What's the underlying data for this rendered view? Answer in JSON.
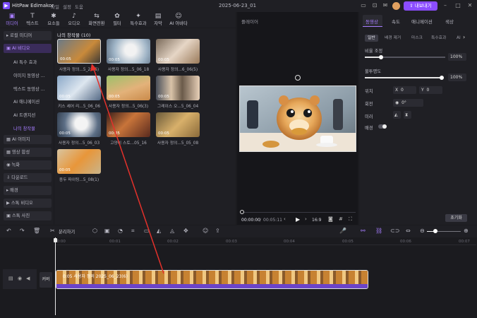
{
  "app": {
    "title": "HitPaw Edimakor",
    "project_title": "2025-06-23_01",
    "export_label": "내보내기"
  },
  "menu": [
    "파일",
    "설정",
    "도움"
  ],
  "toolbar": [
    {
      "label": "미디어",
      "icon": "folder-icon",
      "active": true
    },
    {
      "label": "텍스트",
      "icon": "text-icon"
    },
    {
      "label": "요소들",
      "icon": "elements-icon"
    },
    {
      "label": "오디오",
      "icon": "audio-icon"
    },
    {
      "label": "화면전환",
      "icon": "transition-icon"
    },
    {
      "label": "필터",
      "icon": "filter-icon"
    },
    {
      "label": "특수효과",
      "icon": "effects-icon"
    },
    {
      "label": "자막",
      "icon": "subtitle-icon"
    },
    {
      "label": "AI 아바타",
      "icon": "avatar-icon"
    }
  ],
  "sidebar": {
    "local_media": "로컬 미디어",
    "ai_video": "AI 비디오",
    "ai_sub": [
      "AI 특수 효과",
      "이미지 동영상 ...",
      "텍스트 동영상 ...",
      "AI 애니메이션",
      "AI 트랜지션",
      "나의 창작물"
    ],
    "ai_image": "AI 이미지",
    "video_merge": "영상 합성",
    "record": "녹화",
    "download": "다운로드",
    "background": "배경",
    "stock_video": "스톡 비디오",
    "stock_photo": "스톡 사진"
  },
  "media": {
    "header": "나의 창작물 (10)",
    "items": [
      {
        "label": "사용자 정의...5_23(6)",
        "duration": "00:05"
      },
      {
        "label": "사용자 정의...5_06_18",
        "duration": "00:05"
      },
      {
        "label": "사용자 정의...6_06(5)",
        "duration": "00:05"
      },
      {
        "label": "키스 셰어 리...5_06_06",
        "duration": "00:05"
      },
      {
        "label": "사용자 정의...5_06(3)",
        "duration": "00:05"
      },
      {
        "label": "그레이스 오...5_06_04",
        "duration": "00:05"
      },
      {
        "label": "사용자 정의...5_06_03",
        "duration": "00:05"
      },
      {
        "label": "고양이 스토...05_16",
        "duration": "00:05"
      },
      {
        "label": "사용자 정의...5_05_08",
        "duration": "00:05"
      },
      {
        "label": "종두 파이팅...5_08(1)",
        "duration": "00:05"
      }
    ]
  },
  "preview": {
    "title": "플레이어",
    "current_time": "00:00:00",
    "total_time": "00:05:11",
    "aspect": "16:9"
  },
  "right_panel": {
    "tabs": [
      "동영상",
      "속도",
      "애니메이션",
      "색상"
    ],
    "subtabs": [
      "일반",
      "배경 제거",
      "마스크",
      "특수효과",
      "AI"
    ],
    "scale_label": "비율 조정",
    "scale_value": "100%",
    "scale_fraction": 0.2,
    "opacity_label": "불투명도",
    "opacity_value": "100%",
    "opacity_fraction": 1.0,
    "position_label": "위치",
    "pos_x_label": "X",
    "pos_x": "0",
    "pos_y_label": "Y",
    "pos_y": "0",
    "rotate_label": "회전",
    "rotate_value": "0°",
    "mirror_label": "미러",
    "background_label": "배경",
    "reset_label": "초기화"
  },
  "timeline": {
    "split_label": "분리하기",
    "ticks": [
      "00:00",
      "00:01",
      "00:02",
      "00:03",
      "00:04",
      "00:05",
      "00:06",
      "00:07"
    ],
    "track_label": "커버",
    "clip_label": "0:05 사용자 정의 2025_06_23(6)"
  }
}
